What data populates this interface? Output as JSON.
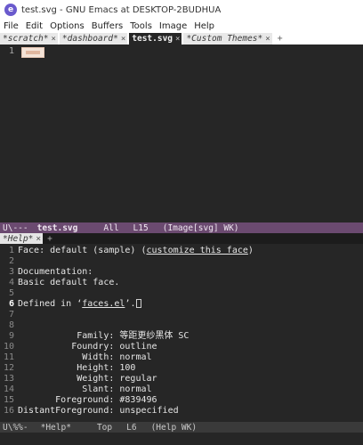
{
  "window": {
    "title": "test.svg - GNU Emacs at DESKTOP-2BUDHUA",
    "icon": "emacs-icon"
  },
  "menubar": {
    "items": [
      "File",
      "Edit",
      "Options",
      "Buffers",
      "Tools",
      "Image",
      "Help"
    ]
  },
  "tabs": {
    "items": [
      {
        "label": "*scratch*",
        "close": "×"
      },
      {
        "label": "*dashboard*",
        "close": "×"
      },
      {
        "label": "test.svg",
        "close": "×"
      },
      {
        "label": "*Custom Themes*",
        "close": "×"
      }
    ],
    "add": "+"
  },
  "top_buffer": {
    "line_number": "1"
  },
  "modeline_top": {
    "status": "U\\---",
    "buffer": "test.svg",
    "position": "All",
    "line": "L15",
    "mode": "(Image[svg] WK)"
  },
  "help_tabbar": {
    "tab_label": "*Help*",
    "close": "×",
    "add": "+"
  },
  "help": {
    "lines": [
      {
        "n": "1",
        "parts": [
          {
            "t": "Face: default (sample) ("
          },
          {
            "t": "customize this face",
            "link": true
          },
          {
            "t": ")"
          }
        ]
      },
      {
        "n": "2",
        "parts": []
      },
      {
        "n": "3",
        "parts": [
          {
            "t": "Documentation:"
          }
        ]
      },
      {
        "n": "4",
        "parts": [
          {
            "t": "Basic default face."
          }
        ]
      },
      {
        "n": "5",
        "parts": []
      },
      {
        "n": "6",
        "current": true,
        "parts": [
          {
            "t": "Defined in ‘"
          },
          {
            "t": "faces.el",
            "link": true
          },
          {
            "t": "’."
          }
        ],
        "cursor": true
      },
      {
        "n": "7",
        "parts": []
      },
      {
        "n": "8",
        "parts": []
      },
      {
        "n": "9",
        "parts": [
          {
            "t": "           Family: 等距更纱黑体 SC"
          }
        ]
      },
      {
        "n": "10",
        "parts": [
          {
            "t": "          Foundry: outline"
          }
        ]
      },
      {
        "n": "11",
        "parts": [
          {
            "t": "            Width: normal"
          }
        ]
      },
      {
        "n": "12",
        "parts": [
          {
            "t": "           Height: 100"
          }
        ]
      },
      {
        "n": "13",
        "parts": [
          {
            "t": "           Weight: regular"
          }
        ]
      },
      {
        "n": "14",
        "parts": [
          {
            "t": "            Slant: normal"
          }
        ]
      },
      {
        "n": "15",
        "parts": [
          {
            "t": "       Foreground: #839496"
          }
        ]
      },
      {
        "n": "16",
        "parts": [
          {
            "t": "DistantForeground: unspecified"
          }
        ]
      }
    ]
  },
  "modeline_bottom": {
    "status": "U\\%%-",
    "buffer": "*Help*",
    "position": "Top",
    "line": "L6",
    "mode": "(Help WK)"
  },
  "colors": {
    "editor_bg": "#262626",
    "modeline_active": "#6b4a70",
    "modeline_inactive": "#3a3a3a",
    "svg_thumb": "#f4e3d7"
  }
}
